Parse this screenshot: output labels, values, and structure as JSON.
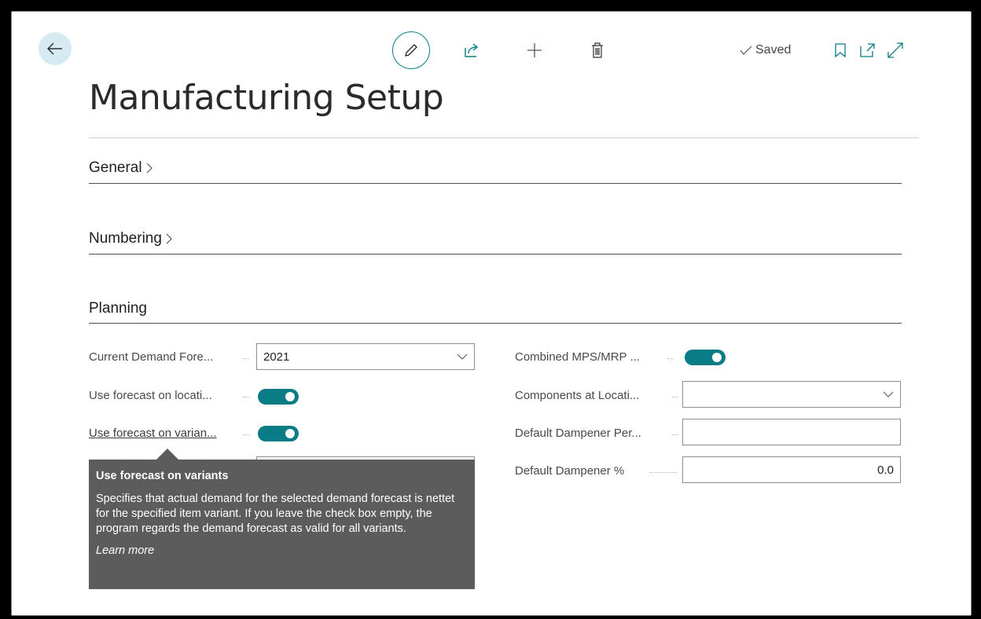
{
  "toolbar": {
    "saved_label": "Saved"
  },
  "page": {
    "title": "Manufacturing Setup"
  },
  "sections": {
    "general": "General",
    "numbering": "Numbering",
    "planning": "Planning"
  },
  "planning": {
    "left": [
      {
        "label": "Current Demand Fore...",
        "value": "2021"
      },
      {
        "label": "Use forecast on locati...",
        "toggle": true
      },
      {
        "label": "Use forecast on varian...",
        "toggle": true
      }
    ],
    "right": [
      {
        "label": "Combined MPS/MRP ...",
        "toggle": true
      },
      {
        "label": "Components at Locati...",
        "value": ""
      },
      {
        "label": "Default Dampener Per...",
        "value": ""
      },
      {
        "label": "Default Dampener %",
        "value": "0.0"
      }
    ]
  },
  "tooltip": {
    "title": "Use forecast on variants",
    "body": "Specifies that actual demand for the selected demand forecast is nettet for the specified item variant. If you leave the check box empty, the program regards the demand forecast as valid for all variants.",
    "link": "Learn more"
  },
  "colors": {
    "accent": "#0a7c86",
    "back_bg": "#d6eaf1",
    "tooltip_bg": "#5c5c5c"
  }
}
